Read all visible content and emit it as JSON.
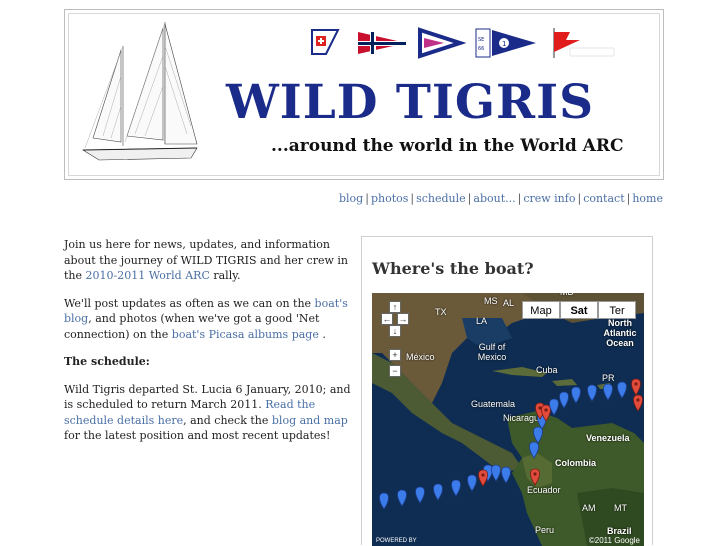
{
  "header": {
    "title": "WILD TIGRIS",
    "tagline": "...around the world in the World ARC"
  },
  "nav": {
    "items": [
      "blog",
      "photos",
      "schedule",
      "about...",
      "crew info",
      "contact",
      "home"
    ]
  },
  "intro": {
    "text_before": "Join us here for news, updates, and information about the journey of WILD TIGRIS and her crew in the ",
    "link": "2010-2011 World ARC",
    "text_after": " rally."
  },
  "updates": {
    "text1": "We'll post updates as often as we can on the ",
    "link1": "boat's blog",
    "text2": ", and photos (when we've got a good 'Net connection) on the ",
    "link2": "boat's Picasa albums page",
    "text3": " ."
  },
  "schedule": {
    "heading": "The schedule:",
    "text1": "Wild Tigris departed St. Lucia 6 January, 2010; and is scheduled to return March 2011. ",
    "link1": "Read the schedule details here",
    "text2": ", and check the ",
    "link2": "blog and map",
    "text3": " for the latest position and most recent updates!"
  },
  "map": {
    "heading": "Where's the boat?",
    "types": [
      "Map",
      "Sat",
      "Ter"
    ],
    "selected_type": "Sat",
    "labels": [
      "MS",
      "AL",
      "TX",
      "LA",
      "MD",
      "México",
      "Gulf of Mexico",
      "Cuba",
      "PR",
      "North Atlantic Ocean",
      "Guatemala",
      "Nicaragua",
      "Venezuela",
      "Colombia",
      "Ecuador",
      "Peru",
      "AM",
      "MT",
      "Brazil"
    ],
    "copyright": "©2011 Google",
    "powered": "POWERED BY"
  },
  "colors": {
    "title": "#1a2b8a",
    "link": "#4a6fa5",
    "marker_blue": "#3b7bea",
    "marker_red": "#e04b3c"
  },
  "icons": [
    "yacht-icon",
    "club-flag-icon",
    "norway-flag-icon",
    "pennant-icon",
    "pennant-icon",
    "pennant-icon",
    "red-pennant-icon",
    "pan-up-icon",
    "pan-left-icon",
    "pan-right-icon",
    "pan-down-icon",
    "zoom-in-icon",
    "zoom-out-icon",
    "map-marker-icon"
  ]
}
